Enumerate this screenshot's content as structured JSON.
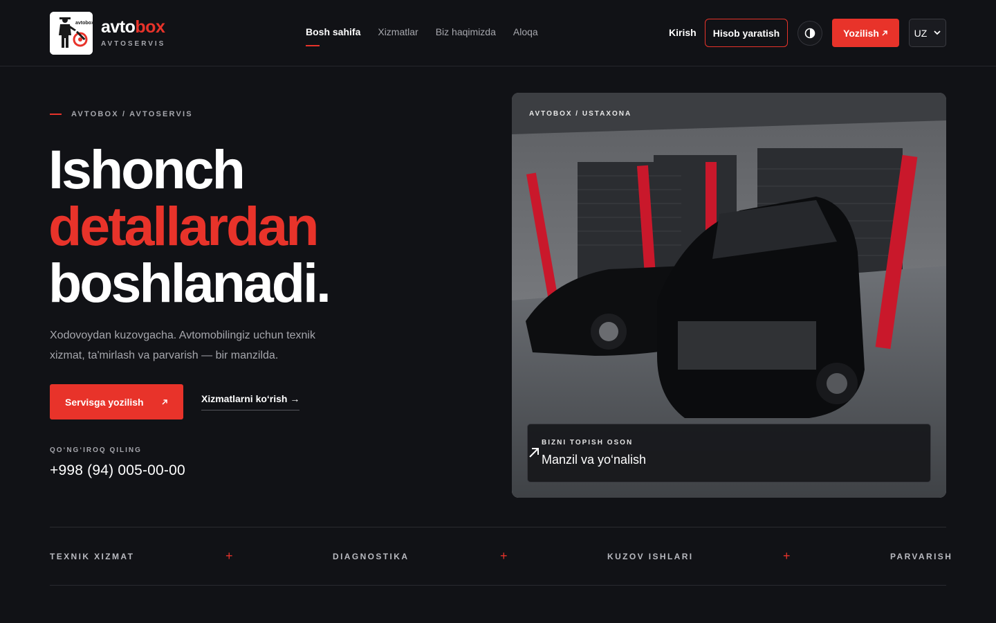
{
  "header": {
    "brand_part1": "avto",
    "brand_part2": "box",
    "brand_sub": "AVTOSERVIS",
    "logo_text": "avtobox",
    "nav": [
      {
        "label": "Bosh sahifa",
        "active": true
      },
      {
        "label": "Xizmatlar",
        "active": false
      },
      {
        "label": "Biz haqimizda",
        "active": false
      },
      {
        "label": "Aloqa",
        "active": false
      }
    ],
    "login_label": "Kirish",
    "register_label": "Hisob yaratish",
    "theme_icon": "contrast-icon",
    "book_label": "Yozilish",
    "book_icon": "arrow-up-right-icon",
    "lang_value": "UZ"
  },
  "hero": {
    "eyebrow": "AVTOBOX / AVTOSERVIS",
    "title_line1": "Ishonch",
    "title_line2": "detallardan",
    "title_line3": "boshlanadi.",
    "lead": "Xodovoydan kuzovgacha. Avtomobilingiz uchun texnik xizmat, ta'mirlash va parvarish — bir manzilda.",
    "cta_label": "Servisga yozilish",
    "secondary_link": "Xizmatlarni ko‘rish →",
    "call_label": "QO‘NG‘IROQ QILING",
    "phone": "+998 (94) 005-00-00"
  },
  "photo": {
    "tag": "AVTOBOX / USTAXONA",
    "card_kicker": "BIZNI TOPISH OSON",
    "card_title": "Manzil va yo‘nalish"
  },
  "services": [
    "TEXNIK XIZMAT",
    "DIAGNOSTIKA",
    "KUZOV ISHLARI",
    "PARVARISH"
  ],
  "colors": {
    "accent": "#e8332a",
    "background": "#111216",
    "muted": "#a6a7ad"
  }
}
